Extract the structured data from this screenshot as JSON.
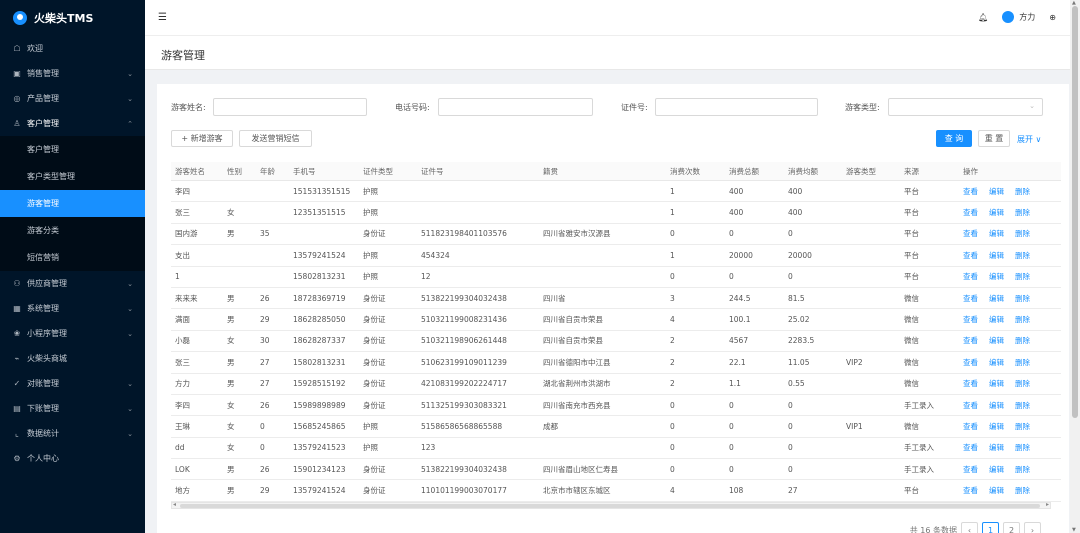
{
  "app": {
    "title": "火柴头TMS"
  },
  "sidebar": {
    "items": [
      {
        "label": "欢迎",
        "icon": "home-icon"
      },
      {
        "label": "销售管理",
        "icon": "sales-icon"
      },
      {
        "label": "产品管理",
        "icon": "product-icon"
      },
      {
        "label": "客户管理",
        "icon": "user-icon"
      },
      {
        "label": "客户管理",
        "icon": ""
      },
      {
        "label": "客户类型管理",
        "icon": ""
      },
      {
        "label": "游客管理",
        "icon": ""
      },
      {
        "label": "游客分类",
        "icon": ""
      },
      {
        "label": "短信营销",
        "icon": ""
      },
      {
        "label": "供应商管理",
        "icon": "supplier-icon"
      },
      {
        "label": "系统管理",
        "icon": "system-icon"
      },
      {
        "label": "小程序管理",
        "icon": "miniprogram-icon"
      },
      {
        "label": "火柴头商城",
        "icon": "mall-icon"
      },
      {
        "label": "对账管理",
        "icon": "reconcile-icon"
      },
      {
        "label": "下账管理",
        "icon": "ledger-icon"
      },
      {
        "label": "数据统计",
        "icon": "stats-icon"
      },
      {
        "label": "个人中心",
        "icon": "settings-icon"
      }
    ]
  },
  "header": {
    "user_name": "方力"
  },
  "page": {
    "title": "游客管理"
  },
  "filters": {
    "name_label": "游客姓名:",
    "phone_label": "电话号码:",
    "id_label": "证件号:",
    "type_label": "游客类型:"
  },
  "actions": {
    "add": "+ 新增游客",
    "sms": "发送营销短信",
    "search": "查 询",
    "reset": "重 置",
    "expand": "展开 ∨"
  },
  "table": {
    "columns": [
      "游客姓名",
      "性别",
      "年龄",
      "手机号",
      "证件类型",
      "证件号",
      "籍贯",
      "消费次数",
      "消费总额",
      "消费均额",
      "游客类型",
      "来源",
      "操作"
    ],
    "op_view": "查看",
    "op_edit": "编辑",
    "op_delete": "删除",
    "rows": [
      [
        "李四",
        "",
        "",
        "151531351515",
        "护照",
        "",
        "",
        "1",
        "400",
        "400",
        "",
        "平台"
      ],
      [
        "张三",
        "女",
        "",
        "12351351515",
        "护照",
        "",
        "",
        "1",
        "400",
        "400",
        "",
        "平台"
      ],
      [
        "国内游",
        "男",
        "35",
        "",
        "身份证",
        "511823198401103576",
        "四川省雅安市汉源县",
        "0",
        "0",
        "0",
        "",
        "平台"
      ],
      [
        "支出",
        "",
        "",
        "13579241524",
        "护照",
        "454324",
        "",
        "1",
        "20000",
        "20000",
        "",
        "平台"
      ],
      [
        "1",
        "",
        "",
        "15802813231",
        "护照",
        "12",
        "",
        "0",
        "0",
        "0",
        "",
        "平台"
      ],
      [
        "来来来",
        "男",
        "26",
        "18728369719",
        "身份证",
        "513822199304032438",
        "四川省",
        "3",
        "244.5",
        "81.5",
        "",
        "微信"
      ],
      [
        "满面",
        "男",
        "29",
        "18628285050",
        "身份证",
        "510321199008231436",
        "四川省自贡市荣县",
        "4",
        "100.1",
        "25.02",
        "",
        "微信"
      ],
      [
        "小磊",
        "女",
        "30",
        "18628287337",
        "身份证",
        "510321198906261448",
        "四川省自贡市荣县",
        "2",
        "4567",
        "2283.5",
        "",
        "微信"
      ],
      [
        "张三",
        "男",
        "27",
        "15802813231",
        "身份证",
        "510623199109011239",
        "四川省德阳市中江县",
        "2",
        "22.1",
        "11.05",
        "VIP2",
        "微信"
      ],
      [
        "方力",
        "男",
        "27",
        "15928515192",
        "身份证",
        "421083199202224717",
        "湖北省荆州市洪湖市",
        "2",
        "1.1",
        "0.55",
        "",
        "微信"
      ],
      [
        "李四",
        "女",
        "26",
        "15989898989",
        "身份证",
        "511325199303083321",
        "四川省南充市西充县",
        "0",
        "0",
        "0",
        "",
        "手工录入"
      ],
      [
        "王琳",
        "女",
        "0",
        "15685245865",
        "护照",
        "51586586568865588",
        "成都",
        "0",
        "0",
        "0",
        "VIP1",
        "微信"
      ],
      [
        "dd",
        "女",
        "0",
        "13579241523",
        "护照",
        "123",
        "",
        "0",
        "0",
        "0",
        "",
        "手工录入"
      ],
      [
        "LOK",
        "男",
        "26",
        "15901234123",
        "身份证",
        "513822199304032438",
        "四川省眉山地区仁寿县",
        "0",
        "0",
        "0",
        "",
        "手工录入"
      ],
      [
        "地方",
        "男",
        "29",
        "13579241524",
        "身份证",
        "110101199003070177",
        "北京市市辖区东城区",
        "4",
        "108",
        "27",
        "",
        "平台"
      ]
    ]
  },
  "pager": {
    "total": "共 16 条数据",
    "prev": "‹",
    "next": "›",
    "page1": "1",
    "page2": "2"
  },
  "colors": {
    "accent": "#1890ff",
    "sidebar_bg": "#001529"
  }
}
